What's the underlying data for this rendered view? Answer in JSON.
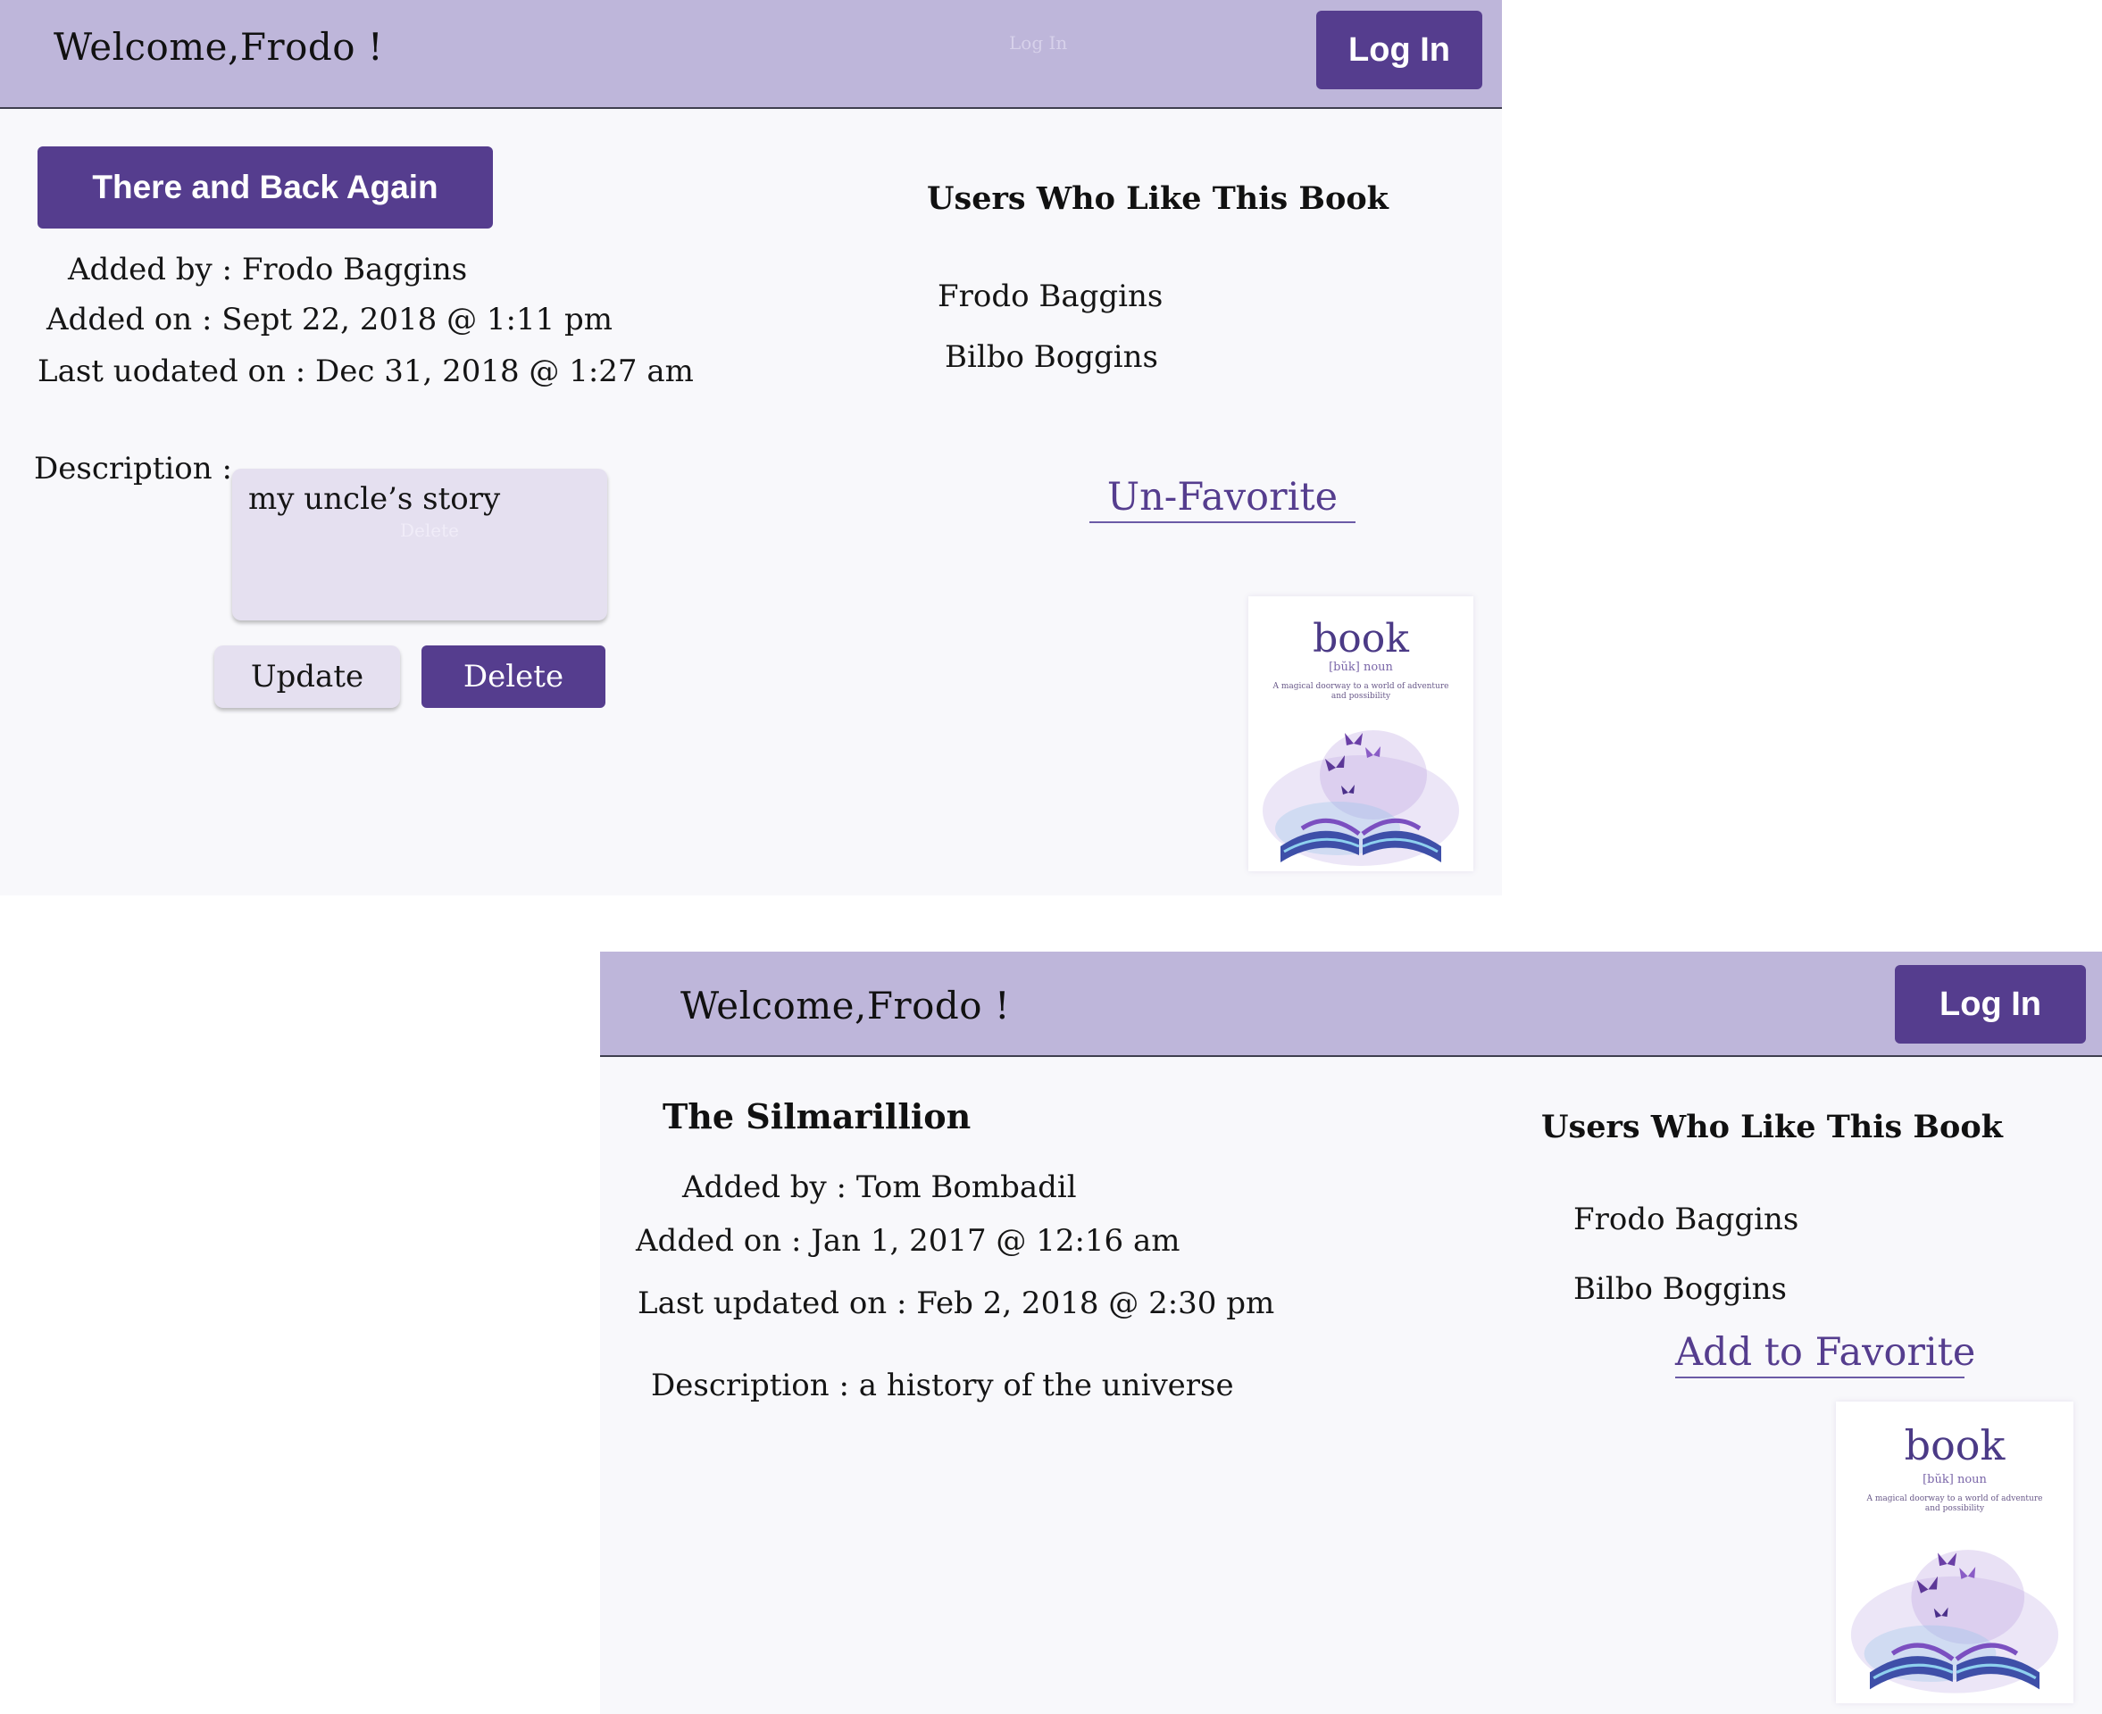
{
  "screens": [
    {
      "header": {
        "welcome": "Welcome,Frodo !",
        "login_label": "Log In",
        "faint_label": "Log In"
      },
      "book": {
        "title": "There and Back Again",
        "added_by": "Added by : Frodo Baggins",
        "added_on": "Added on : Sept 22, 2018 @ 1:11 pm",
        "last_updated": "Last uodated on : Dec 31, 2018 @ 1:27 am",
        "description_label": "Description :",
        "description_value": "my uncle’s story",
        "faint_label": "Delete",
        "update_label": "Update",
        "delete_label": "Delete"
      },
      "likes": {
        "heading": "Users Who Like This Book",
        "users": [
          "Frodo Baggins",
          "Bilbo Boggins"
        ],
        "favorite_label": "Un-Favorite"
      },
      "cover": {
        "word": "book",
        "pronunciation": "[bŭk] noun",
        "tagline": "A magical doorway to a world of adventure and possibility",
        "icon": "open-book-with-butterflies"
      }
    },
    {
      "header": {
        "welcome": "Welcome,Frodo !",
        "login_label": "Log In"
      },
      "book": {
        "title": "The Silmarillion",
        "added_by": "Added by : Tom Bombadil",
        "added_on": "Added on : Jan 1, 2017 @ 12:16 am",
        "last_updated": "Last updated on : Feb 2, 2018 @ 2:30 pm",
        "description": "Description : a history of the universe"
      },
      "likes": {
        "heading": "Users Who Like This Book",
        "users": [
          "Frodo Baggins",
          "Bilbo Boggins"
        ],
        "favorite_label": "Add to Favorite"
      },
      "cover": {
        "word": "book",
        "pronunciation": "[bŭk] noun",
        "tagline": "A magical doorway to a world of adventure and possibility",
        "icon": "open-book-with-butterflies"
      }
    }
  ],
  "colors": {
    "header_bg": "#beb6da",
    "accent": "#553d8e",
    "page_bg": "#f8f8fb",
    "input_bg": "#e5e0f0"
  }
}
